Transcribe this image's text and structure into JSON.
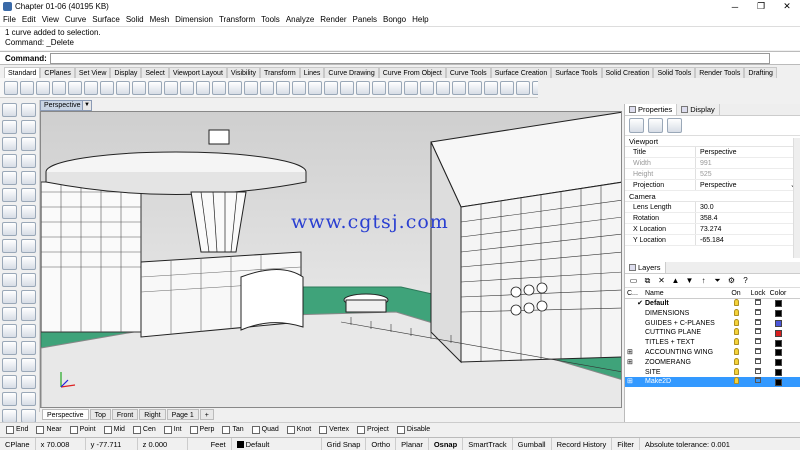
{
  "window": {
    "title": "Chapter 01-06 (40195 KB)"
  },
  "menu": [
    "File",
    "Edit",
    "View",
    "Curve",
    "Surface",
    "Solid",
    "Mesh",
    "Dimension",
    "Transform",
    "Tools",
    "Analyze",
    "Render",
    "Panels",
    "Bongo",
    "Help"
  ],
  "command_history": [
    "1 curve added to selection.",
    "Command: _Delete"
  ],
  "command": {
    "label": "Command:",
    "value": ""
  },
  "toolbar_tabs": [
    "Standard",
    "CPlanes",
    "Set View",
    "Display",
    "Select",
    "Viewport Layout",
    "Visibility",
    "Transform",
    "Lines",
    "Curve Drawing",
    "Curve From Object",
    "Curve Tools",
    "Surface Creation",
    "Surface Tools",
    "Solid Creation",
    "Solid Tools",
    "Render Tools",
    "Drafting"
  ],
  "active_toolbar_tab": "Standard",
  "viewport": {
    "title": "Perspective",
    "watermark": "www.cgtsj.com",
    "ground_color": "#3fa37a"
  },
  "viewport_tabs": [
    "Perspective",
    "Top",
    "Front",
    "Right",
    "Page 1",
    "+"
  ],
  "properties": {
    "tabs": [
      "Properties",
      "Display"
    ],
    "sections": [
      {
        "title": "Viewport",
        "rows": [
          {
            "label": "Title",
            "value": "Perspective",
            "dim": false
          },
          {
            "label": "Width",
            "value": "991",
            "dim": true
          },
          {
            "label": "Height",
            "value": "525",
            "dim": true
          },
          {
            "label": "Projection",
            "value": "Perspective",
            "dim": false,
            "dropdown": true
          }
        ]
      },
      {
        "title": "Camera",
        "rows": [
          {
            "label": "Lens Length",
            "value": "30.0",
            "dim": false
          },
          {
            "label": "Rotation",
            "value": "358.4",
            "dim": false
          },
          {
            "label": "X Location",
            "value": "73.274",
            "dim": false
          },
          {
            "label": "Y Location",
            "value": "-65.184",
            "dim": false
          }
        ]
      }
    ]
  },
  "layers": {
    "tab": "Layers",
    "columns": {
      "current": "C...",
      "name": "Name",
      "on": "On",
      "lock": "Lock",
      "color": "Color"
    },
    "rows": [
      {
        "name": "Default",
        "current": true,
        "expand": "",
        "color": "#000000",
        "bold": true,
        "selected": false
      },
      {
        "name": "DIMENSIONS",
        "current": false,
        "expand": "",
        "color": "#000000",
        "selected": false
      },
      {
        "name": "GUIDES + C-PLANES",
        "current": false,
        "expand": "",
        "color": "#4a55d8",
        "selected": false
      },
      {
        "name": "CUTTING PLANE",
        "current": false,
        "expand": "",
        "color": "#d81e1e",
        "selected": false
      },
      {
        "name": "TITLES + TEXT",
        "current": false,
        "expand": "",
        "color": "#000000",
        "selected": false
      },
      {
        "name": "ACCOUNTING WING",
        "current": false,
        "expand": "⊞",
        "color": "#000000",
        "selected": false
      },
      {
        "name": "ZOOMERANG",
        "current": false,
        "expand": "⊞",
        "color": "#000000",
        "selected": false
      },
      {
        "name": "SITE",
        "current": false,
        "expand": "",
        "color": "#000000",
        "selected": false
      },
      {
        "name": "Make2D",
        "current": false,
        "expand": "⊞",
        "color": "#000000",
        "selected": true
      }
    ]
  },
  "osnaps": [
    {
      "label": "End",
      "checked": false
    },
    {
      "label": "Near",
      "checked": false
    },
    {
      "label": "Point",
      "checked": false
    },
    {
      "label": "Mid",
      "checked": false
    },
    {
      "label": "Cen",
      "checked": false
    },
    {
      "label": "Int",
      "checked": false
    },
    {
      "label": "Perp",
      "checked": false
    },
    {
      "label": "Tan",
      "checked": false
    },
    {
      "label": "Quad",
      "checked": false
    },
    {
      "label": "Knot",
      "checked": false
    },
    {
      "label": "Vertex",
      "checked": false
    },
    {
      "label": "Project",
      "checked": false
    },
    {
      "label": "Disable",
      "checked": false
    }
  ],
  "status": {
    "cplane": "CPlane",
    "x": "x 70.008",
    "y": "y -77.711",
    "z": "z 0.000",
    "units": "Feet",
    "layer": "Default",
    "toggles": [
      "Grid Snap",
      "Ortho",
      "Planar",
      "Osnap",
      "SmartTrack",
      "Gumball",
      "Record History",
      "Filter"
    ],
    "bold_toggle": "Osnap",
    "tolerance": "Absolute tolerance: 0.001"
  }
}
